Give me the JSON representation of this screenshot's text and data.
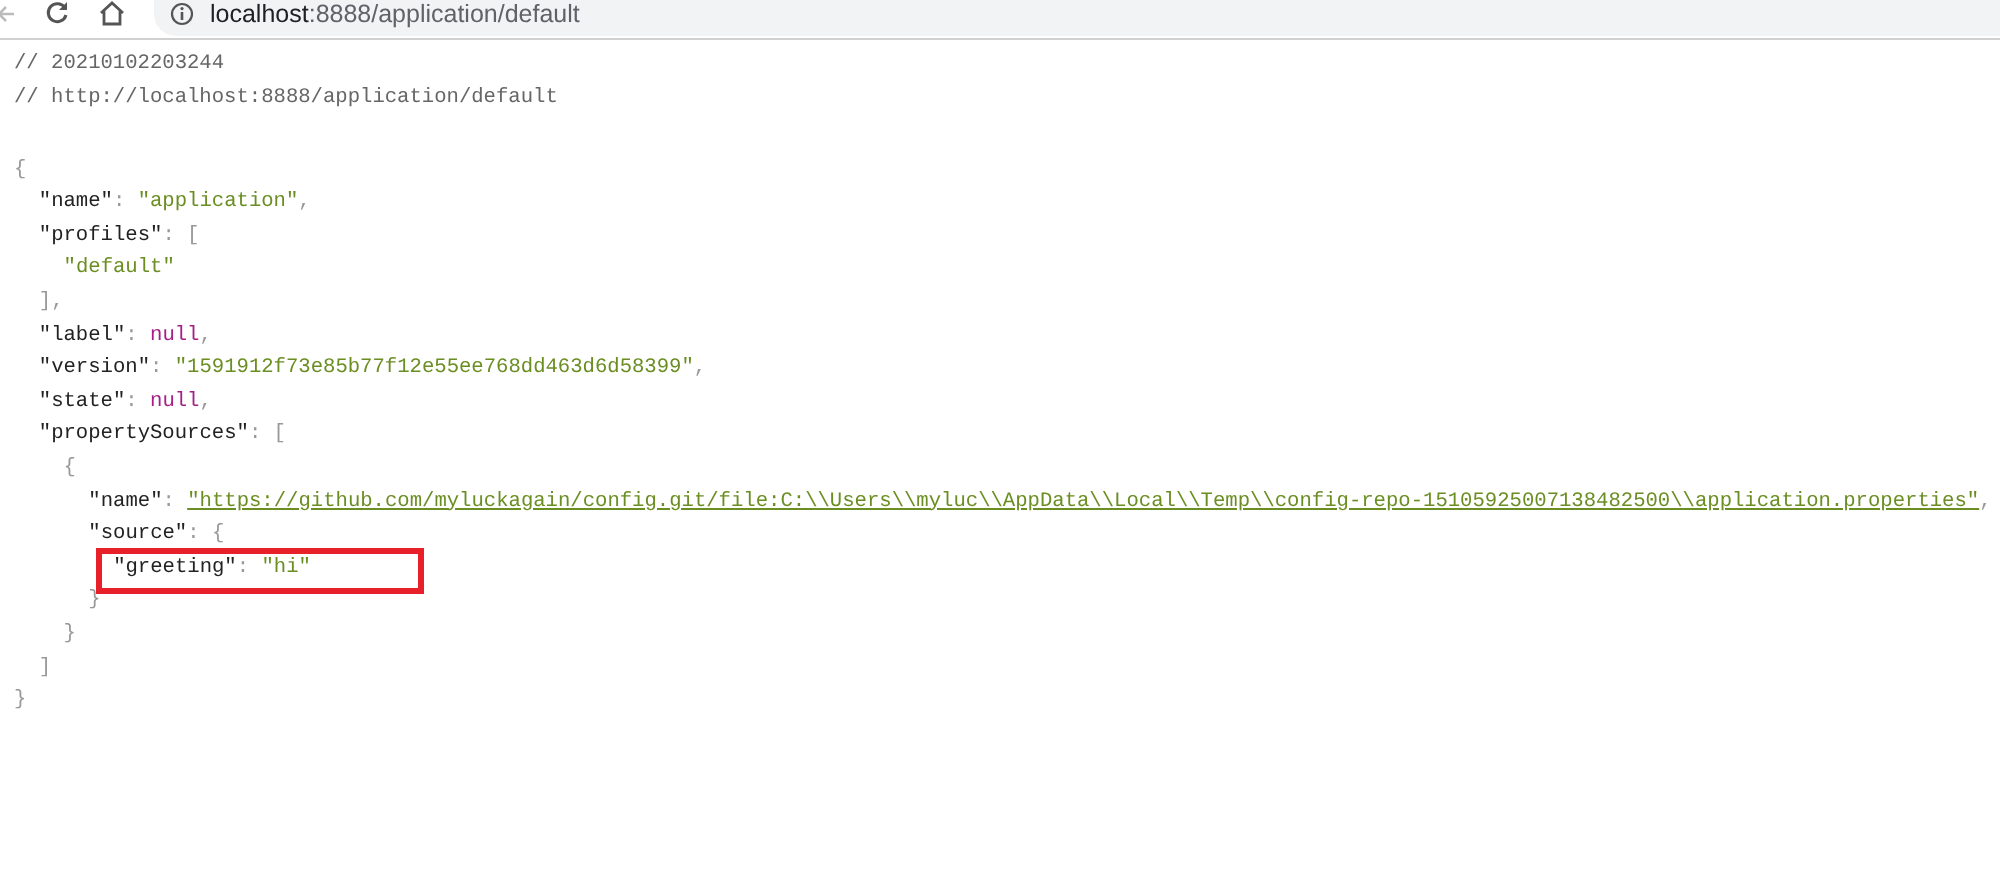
{
  "browser": {
    "url_host": "localhost",
    "url_path": ":8888/application/default"
  },
  "comments": [
    "// 20210102203244",
    "// http://localhost:8888/application/default"
  ],
  "lines": [
    {
      "highlighted": false,
      "tokens": [
        {
          "kind": "punct",
          "text": "{"
        }
      ],
      "children": [
        {
          "highlighted": false,
          "tokens": [
            {
              "kind": "key",
              "text": "\"name\""
            },
            {
              "kind": "punct",
              "text": ": "
            },
            {
              "kind": "string",
              "text": "\"application\""
            },
            {
              "kind": "punct",
              "text": ","
            }
          ]
        },
        {
          "highlighted": false,
          "tokens": [
            {
              "kind": "key",
              "text": "\"profiles\""
            },
            {
              "kind": "punct",
              "text": ": ["
            }
          ],
          "children": [
            {
              "highlighted": false,
              "tokens": [
                {
                  "kind": "string",
                  "text": "\"default\""
                }
              ]
            }
          ]
        },
        {
          "highlighted": false,
          "tokens": [
            {
              "kind": "punct",
              "text": "],"
            }
          ]
        },
        {
          "highlighted": false,
          "tokens": [
            {
              "kind": "key",
              "text": "\"label\""
            },
            {
              "kind": "punct",
              "text": ": "
            },
            {
              "kind": "null",
              "text": "null"
            },
            {
              "kind": "punct",
              "text": ","
            }
          ]
        },
        {
          "highlighted": false,
          "tokens": [
            {
              "kind": "key",
              "text": "\"version\""
            },
            {
              "kind": "punct",
              "text": ": "
            },
            {
              "kind": "string",
              "text": "\"1591912f73e85b77f12e55ee768dd463d6d58399\""
            },
            {
              "kind": "punct",
              "text": ","
            }
          ]
        },
        {
          "highlighted": false,
          "tokens": [
            {
              "kind": "key",
              "text": "\"state\""
            },
            {
              "kind": "punct",
              "text": ": "
            },
            {
              "kind": "null",
              "text": "null"
            },
            {
              "kind": "punct",
              "text": ","
            }
          ]
        },
        {
          "highlighted": false,
          "tokens": [
            {
              "kind": "key",
              "text": "\"propertySources\""
            },
            {
              "kind": "punct",
              "text": ": ["
            }
          ],
          "children": [
            {
              "highlighted": false,
              "tokens": [
                {
                  "kind": "punct",
                  "text": "{"
                }
              ],
              "children": [
                {
                  "highlighted": false,
                  "tokens": [
                    {
                      "kind": "key",
                      "text": "\"name\""
                    },
                    {
                      "kind": "punct",
                      "text": ": "
                    },
                    {
                      "kind": "link",
                      "text": "\"https://github.com/myluckagain/config.git/file:C:\\\\Users\\\\myluc\\\\AppData\\\\Local\\\\Temp\\\\config-repo-15105925007138482500\\\\application.properties\""
                    },
                    {
                      "kind": "punct",
                      "text": ","
                    }
                  ]
                },
                {
                  "highlighted": false,
                  "tokens": [
                    {
                      "kind": "key",
                      "text": "\"source\""
                    },
                    {
                      "kind": "punct",
                      "text": ": {"
                    }
                  ],
                  "children": [
                    {
                      "highlighted": true,
                      "tokens": [
                        {
                          "kind": "key",
                          "text": "\"greeting\""
                        },
                        {
                          "kind": "punct",
                          "text": ": "
                        },
                        {
                          "kind": "string",
                          "text": "\"hi\""
                        }
                      ]
                    }
                  ]
                },
                {
                  "highlighted": false,
                  "tokens": [
                    {
                      "kind": "punct",
                      "text": "}"
                    }
                  ]
                }
              ]
            },
            {
              "highlighted": false,
              "tokens": [
                {
                  "kind": "punct",
                  "text": "}"
                }
              ]
            }
          ]
        },
        {
          "highlighted": false,
          "tokens": [
            {
              "kind": "punct",
              "text": "]"
            }
          ]
        }
      ]
    },
    {
      "highlighted": false,
      "tokens": [
        {
          "kind": "punct",
          "text": "}"
        }
      ]
    }
  ]
}
